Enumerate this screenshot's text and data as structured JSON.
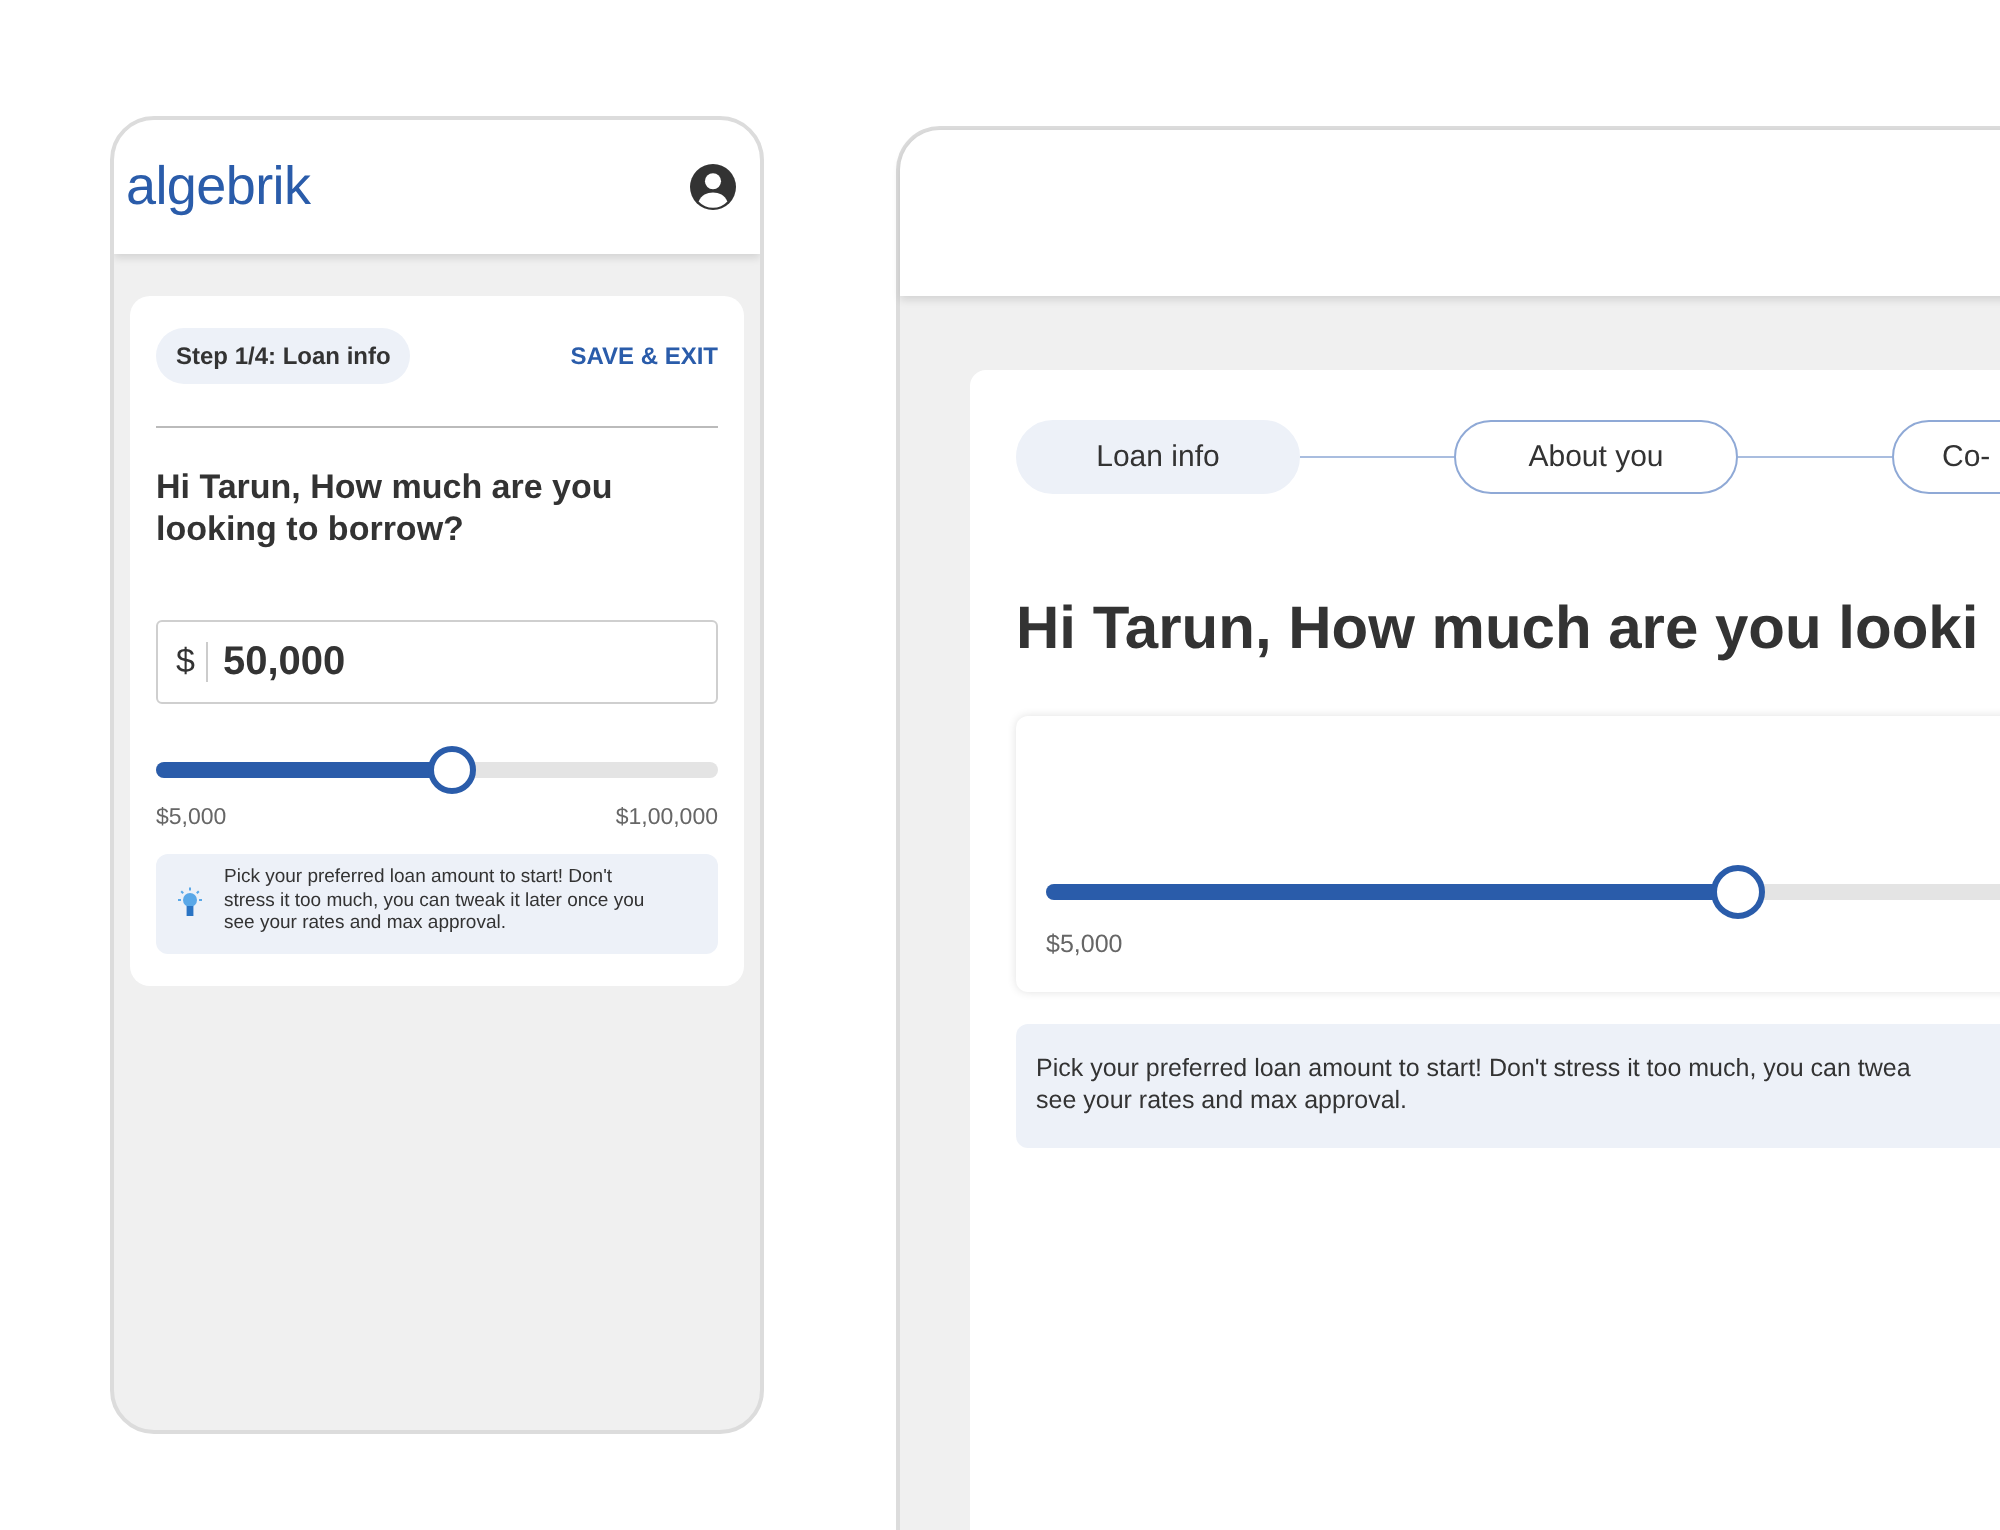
{
  "mobile": {
    "logo": "algebrik",
    "step": "Step 1/4: Loan info",
    "save_exit": "SAVE & EXIT",
    "question": "Hi Tarun, How much are you looking to borrow?",
    "amount": {
      "prefix": "$",
      "value": "50,000"
    },
    "slider": {
      "level": 0.525,
      "min_label": "$5,000",
      "max_label": "$1,00,000"
    },
    "tip": "Pick your preferred loan amount to start! Don't stress it too much, you can tweak it later once you see your rates and max approval."
  },
  "desktop": {
    "steps": [
      {
        "label": "Loan info",
        "selected": true
      },
      {
        "label": "About you",
        "selected": false
      },
      {
        "label": "Co-",
        "selected": false
      }
    ],
    "heading": "Hi Tarun, How much are you looki",
    "slider": {
      "level": 0.525,
      "min_label": "$5,000"
    },
    "tip": "Pick your preferred loan amount to start! Don't stress it too much, you can twea\nsee your rates and max approval."
  }
}
